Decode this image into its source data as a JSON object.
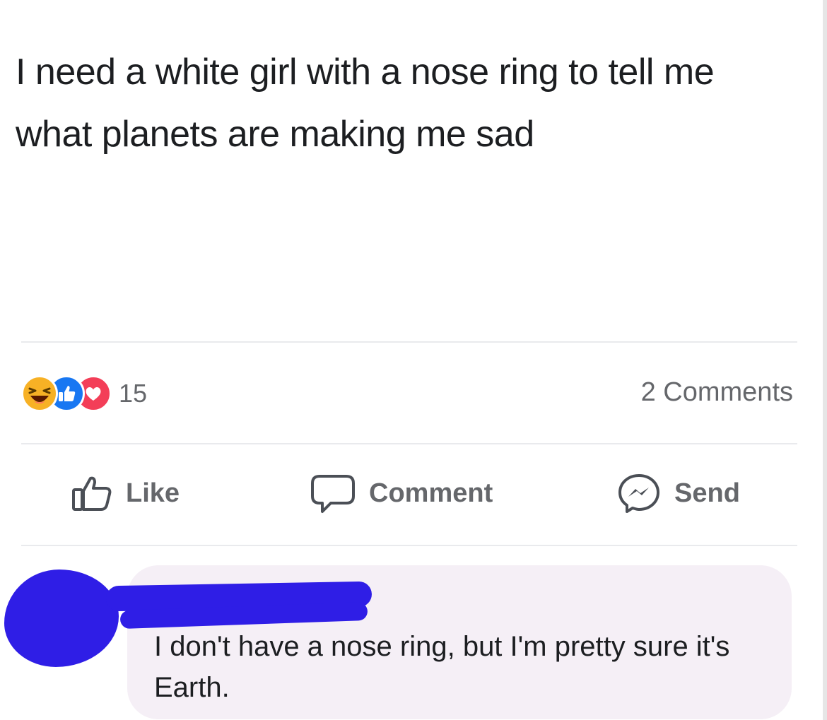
{
  "post": {
    "text": "I need a white girl with a nose ring to tell me what planets are making me sad"
  },
  "reactions": {
    "icons": [
      "haha-reaction-icon",
      "like-reaction-icon",
      "love-reaction-icon"
    ],
    "count": "15"
  },
  "comments_count": "2 Comments",
  "actions": {
    "like_label": "Like",
    "comment_label": "Comment",
    "send_label": "Send"
  },
  "comment": {
    "text": "I don't have a nose ring, but I'm pretty sure it's Earth."
  },
  "colors": {
    "like_blue": "#1877f2",
    "love_red": "#f33e58",
    "haha_yellow": "#f7b125",
    "muted_text": "#65676b",
    "comment_bubble": "#f5eff6",
    "redaction_blue": "#2f1ee6"
  }
}
